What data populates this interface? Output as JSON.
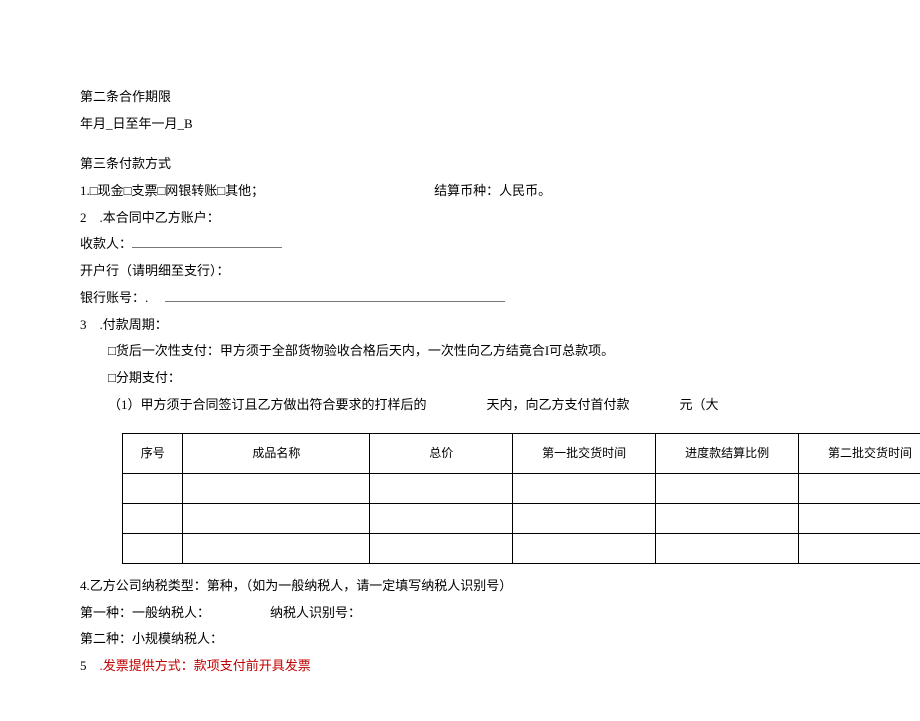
{
  "article2": {
    "title": "第二条合作期限",
    "date_range": "年月_日至年一月_B"
  },
  "article3": {
    "title": "第三条付款方式",
    "item1": {
      "left": "1.□现金□支票□网银转账□其他；",
      "right": "结算币种：人民币。"
    },
    "item2": {
      "intro": "2 .本合同中乙方账户：",
      "payee_label": "收款人：",
      "bank_label": "开户行（请明细至支行）：",
      "account_label": "银行账号：",
      "blank_long_filler": ". "
    },
    "item3": {
      "intro": "3 .付款周期：",
      "option1": "□货后一次性支付：甲方须于全部货物验收合格后天内，一次性向乙方结竟合I可总款项。",
      "option2": "□分期支付：",
      "sub1_a": "（1）甲方须于合同签订且乙方做出符合要求的打样后的",
      "sub1_b": "天内，向乙方支付首付款",
      "sub1_c": "元（大"
    }
  },
  "table": {
    "headers": [
      "序号",
      "成品名称",
      "总价",
      "第一批交货时间",
      "进度款结算比例",
      "第二批交货时间"
    ],
    "rows": [
      [
        "",
        "",
        "",
        "",
        "",
        ""
      ],
      [
        "",
        "",
        "",
        "",
        "",
        ""
      ],
      [
        "",
        "",
        "",
        "",
        "",
        ""
      ]
    ]
  },
  "article3_cont": {
    "item4": "4.乙方公司纳税类型：第种，（如为一般纳税人，请一定填写纳税人识别号）",
    "type1_a": "第一种：一般纳税人：",
    "type1_b": "纳税人识别号：",
    "type2": "第二种：小规模纳税人：",
    "item5_num": "5 ",
    "item5_text": ".发票提供方式：款项支付前开具发票"
  }
}
